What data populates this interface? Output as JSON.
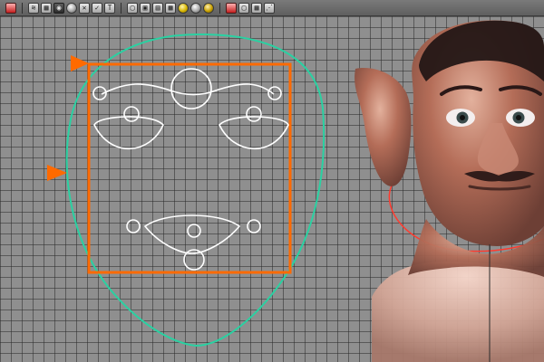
{
  "toolbar": {
    "buttons": [
      {
        "name": "select-tool-icon"
      },
      {
        "name": "render-frame-icon"
      },
      {
        "name": "ipr-render-icon"
      },
      {
        "name": "snapshot-icon"
      },
      {
        "name": "sphere-material-icon"
      },
      {
        "name": "wireframe-x-icon"
      },
      {
        "name": "checkbox-toggle-icon"
      },
      {
        "name": "text-tool-icon"
      },
      {
        "name": "cube-icon"
      },
      {
        "name": "cube-shaded-icon"
      },
      {
        "name": "cube-textured-icon"
      },
      {
        "name": "checker-icon"
      },
      {
        "name": "yellow-sphere-icon"
      },
      {
        "name": "gray-sphere-icon"
      },
      {
        "name": "gold-sphere-icon"
      },
      {
        "name": "isolate-icon"
      },
      {
        "name": "cube-wire-icon"
      },
      {
        "name": "split-view-icon"
      },
      {
        "name": "share-icon"
      }
    ],
    "text_t": "T"
  },
  "colors": {
    "grid_background": "#8f8f8f",
    "accent_orange": "#ff6a00",
    "face_outline": "#2ad1a2",
    "controls": "#ffffff",
    "head_skin": "#b46d58",
    "head_dark": "#241716",
    "curve_red": "#ff3b2f"
  }
}
